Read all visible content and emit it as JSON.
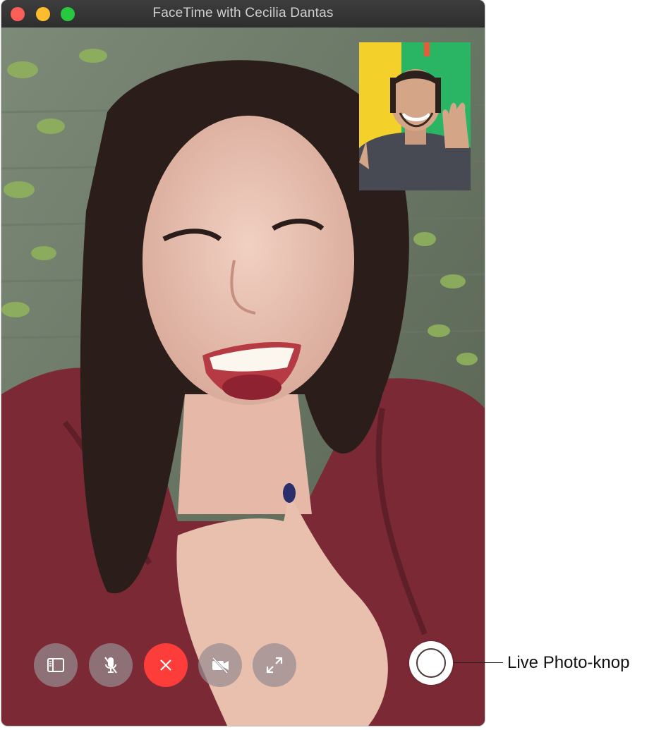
{
  "window": {
    "title": "FaceTime with Cecilia Dantas"
  },
  "remote_video": {
    "description_icon": "remote-person-video"
  },
  "self_view": {
    "icon": "self-view-video"
  },
  "controls": [
    {
      "id": "sidebar",
      "icon": "sidebar-icon"
    },
    {
      "id": "mute",
      "icon": "microphone-muted-icon"
    },
    {
      "id": "end",
      "icon": "close-icon"
    },
    {
      "id": "camera",
      "icon": "video-off-icon"
    },
    {
      "id": "fullscreen",
      "icon": "expand-icon"
    }
  ],
  "live_photo": {
    "callout": "Live Photo-knop"
  },
  "colors": {
    "close": "#fc5f57",
    "minimize": "#fdbc2e",
    "zoom": "#28c840",
    "end_call": "#fc3d39"
  }
}
